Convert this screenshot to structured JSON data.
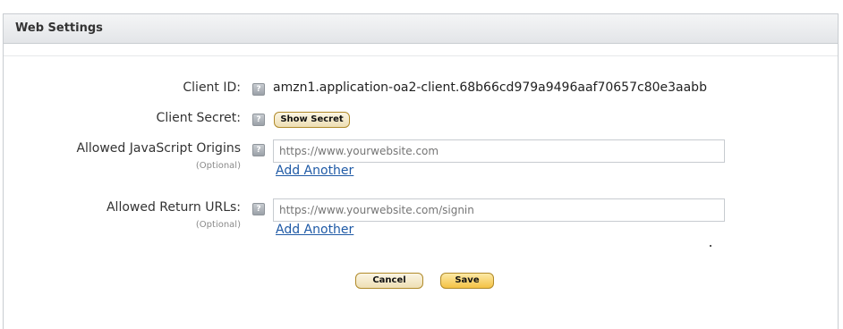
{
  "top_caption": "",
  "panel": {
    "title": "Web Settings"
  },
  "fields": {
    "client_id": {
      "label": "Client ID:",
      "value": "amzn1.application-oa2-client.68b66cd979a9496aaf70657c80e3aabb"
    },
    "client_secret": {
      "label": "Client Secret:",
      "button_label": "Show Secret"
    },
    "js_origins": {
      "label": "Allowed JavaScript Origins",
      "optional_note": "(Optional)",
      "placeholder": "https://www.yourwebsite.com",
      "add_link": "Add Another"
    },
    "return_urls": {
      "label": "Allowed Return URLs:",
      "optional_note": "(Optional)",
      "placeholder": "https://www.yourwebsite.com/signin",
      "add_link": "Add Another"
    }
  },
  "actions": {
    "cancel_label": "Cancel",
    "save_label": "Save"
  },
  "icons": {
    "help": "help-icon"
  },
  "colors": {
    "link": "#1f5aa6",
    "primary_button": "#f4c245",
    "secondary_button": "#eedfb4",
    "header_bg": "#e3e5e8"
  }
}
